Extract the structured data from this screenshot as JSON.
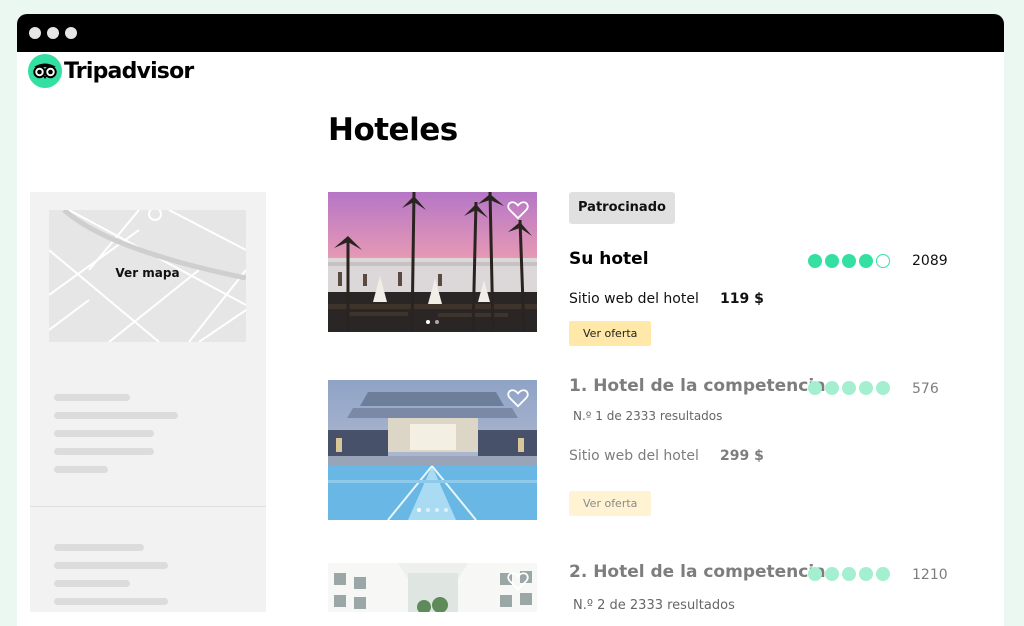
{
  "brand": {
    "name": "Tripadvisor",
    "accent": "#34e0a1"
  },
  "page": {
    "title": "Hoteles"
  },
  "sidebar": {
    "map_label": "Ver mapa"
  },
  "listings": [
    {
      "sponsored_label": "Patrocinado",
      "name": "Su hotel",
      "rating": 4,
      "reviews": "2089",
      "site_label": "Sitio web del hotel",
      "price": "119 $",
      "offer_label": "Ver oferta"
    },
    {
      "name": "1. Hotel de la competencia",
      "rank": "N.º 1 de 2333 resultados",
      "rating": 5,
      "reviews": "576",
      "site_label": "Sitio web del hotel",
      "price": "299 $",
      "offer_label": "Ver oferta"
    },
    {
      "name": "2. Hotel de la competencia",
      "rank": "N.º 2 de 2333 resultados",
      "rating": 5,
      "reviews": "1210"
    }
  ],
  "colors": {
    "offer_button": "#ffe8a8",
    "bubble_fill": "#34e0a1",
    "titlebar": "#000000",
    "sidebar": "#f2f2f2"
  }
}
